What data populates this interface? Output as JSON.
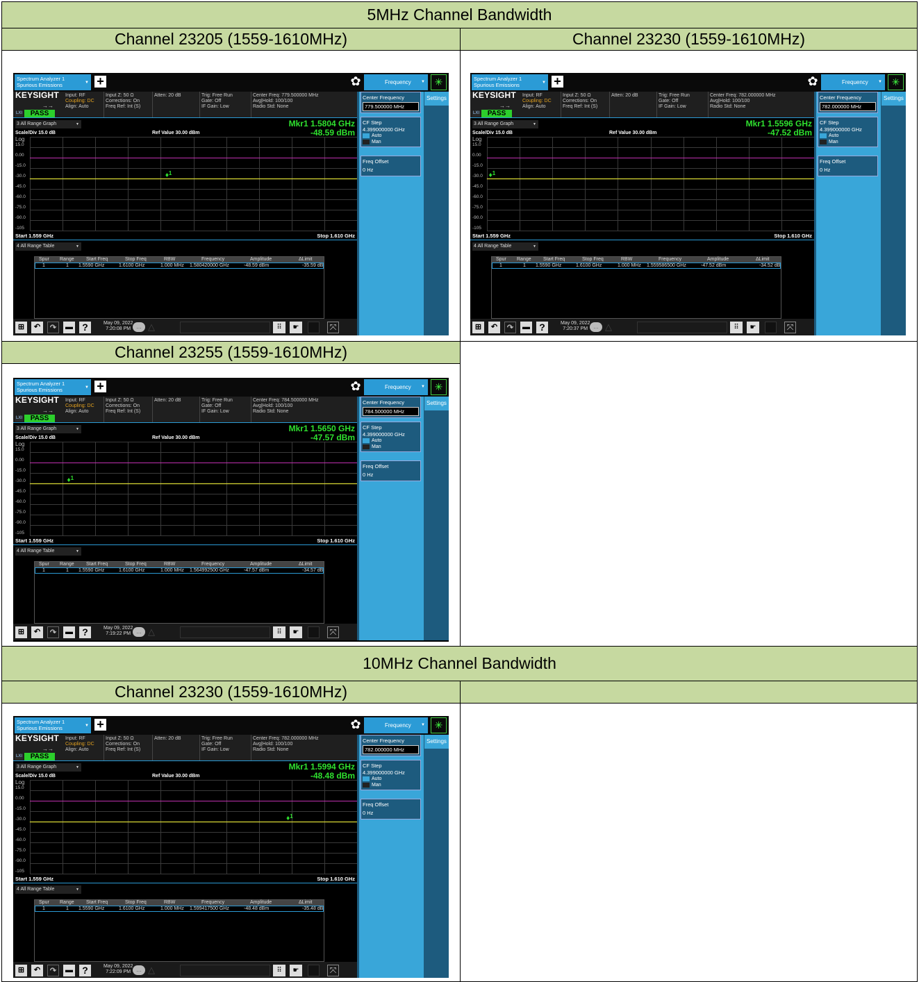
{
  "sections": [
    {
      "title": "5MHz Channel Bandwidth"
    },
    {
      "title": "10MHz Channel Bandwidth"
    }
  ],
  "panels": [
    {
      "caption": "Channel 23205 (1559-1610MHz)",
      "center_freq_info": "Center Freq: 779.500000 MHz",
      "center_freq_value": "779.500000 MHz",
      "mkr_freq": "Mkr1  1.5804 GHz",
      "mkr_amp": "-48.59 dBm",
      "marker_x_fraction": 0.42,
      "date": "May 09, 2022",
      "time": "7:20:08 PM",
      "row": {
        "spur": "1",
        "range": "1",
        "start": "1.5590 GHz",
        "stop": "1.6100 GHz",
        "rbw": "1.000 MHz",
        "freq": "1.580420000 GHz",
        "amp": "-48.59 dBm",
        "limit": "-35.59 dB"
      }
    },
    {
      "caption": "Channel 23230 (1559-1610MHz)",
      "center_freq_info": "Center Freq: 782.000000 MHz",
      "center_freq_value": "782.000000 MHz",
      "mkr_freq": "Mkr1  1.5596 GHz",
      "mkr_amp": "-47.52 dBm",
      "marker_x_fraction": 0.012,
      "date": "May 09, 2022",
      "time": "7:20:37 PM",
      "row": {
        "spur": "1",
        "range": "1",
        "start": "1.5590 GHz",
        "stop": "1.6100 GHz",
        "rbw": "1.000 MHz",
        "freq": "1.559586500 GHz",
        "amp": "-47.52 dBm",
        "limit": "-34.52 dB"
      }
    },
    {
      "caption": "Channel 23255 (1559-1610MHz)",
      "center_freq_info": "Center Freq: 784.500000 MHz",
      "center_freq_value": "784.500000 MHz",
      "mkr_freq": "Mkr1  1.5650 GHz",
      "mkr_amp": "-47.57 dBm",
      "marker_x_fraction": 0.12,
      "date": "May 09, 2022",
      "time": "7:19:22 PM",
      "row": {
        "spur": "1",
        "range": "1",
        "start": "1.5590 GHz",
        "stop": "1.6100 GHz",
        "rbw": "1.000 MHz",
        "freq": "1.564992500 GHz",
        "amp": "-47.57 dBm",
        "limit": "-34.57 dB"
      }
    },
    {
      "caption": "Channel 23230 (1559-1610MHz)",
      "center_freq_info": "Center Freq: 782.000000 MHz",
      "center_freq_value": "782.000000 MHz",
      "mkr_freq": "Mkr1  1.5994 GHz",
      "mkr_amp": "-48.48 dBm",
      "marker_x_fraction": 0.79,
      "date": "May 09, 2022",
      "time": "7:22:09 PM",
      "row": {
        "spur": "1",
        "range": "1",
        "start": "1.5590 GHz",
        "stop": "1.6100 GHz",
        "rbw": "1.000 MHz",
        "freq": "1.599417500 GHz",
        "amp": "-48.48 dBm",
        "limit": "-35.48 dB"
      }
    }
  ],
  "common": {
    "app_tab_line1": "Spectrum Analyzer 1",
    "app_tab_line2": "Spurious Emissions",
    "brand": "KEYSIGHT",
    "input": "Input: RF",
    "coupling": "Coupling: DC",
    "align": "Align: Auto",
    "input_z": "Input Z: 50 Ω",
    "corrections": "Corrections: On",
    "freq_ref": "Freq Ref: Int (S)",
    "atten": "Atten: 20 dB",
    "trig": "Trig: Free Run",
    "gate": "Gate: Off",
    "if_gain": "IF Gain: Low",
    "avg_hold": "Avg|Hold: 100/100",
    "radio_std": "Radio Std: None",
    "lxi": "LXI",
    "pass": "PASS",
    "freq_tab": "Frequency",
    "settings": "Settings",
    "graph_select": "3 All Range Graph",
    "table_select": "4 All Range Table",
    "scale": "Scale/Div 15.0 dB",
    "ref_value": "Ref Value 30.00 dBm",
    "log": "Log",
    "y_ticks": [
      "15.0",
      "0.00",
      "-15.0",
      "-30.0",
      "-45.0",
      "-60.0",
      "-75.0",
      "-90.0",
      "-105"
    ],
    "start": "Start 1.559 GHz",
    "stop": "Stop 1.610 GHz",
    "marker_label": "1",
    "headers": {
      "spur": "Spur",
      "range": "Range",
      "start": "Start Freq",
      "stop": "Stop Freq",
      "rbw": "RBW",
      "freq": "Frequency",
      "amp": "Amplitude",
      "limit": "ΔLimit"
    },
    "cf_label": "Center Frequency",
    "cf_step_label": "CF Step",
    "cf_step_value": "4.399000000 GHz",
    "auto": "Auto",
    "man": "Man",
    "freq_offset_label": "Freq Offset",
    "freq_offset_value": "0 Hz"
  }
}
